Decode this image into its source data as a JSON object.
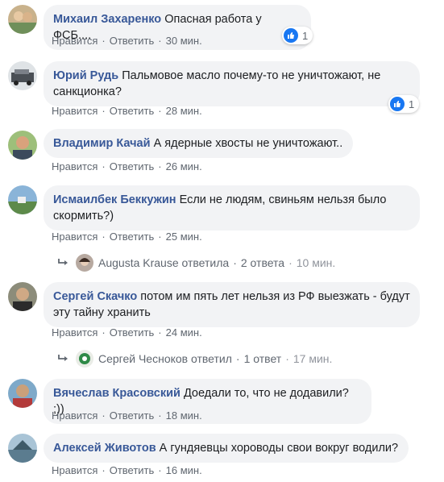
{
  "comments": [
    {
      "author": "Михаил Захаренко",
      "text": "Опасная работа у ФСБ....",
      "like": "Нравится",
      "reply": "Ответить",
      "time": "30 мин.",
      "reactions": "1"
    },
    {
      "author": "Юрий Рудь",
      "text": "Пальмовое масло почему-то не уничтожают, не санкционка?",
      "like": "Нравится",
      "reply": "Ответить",
      "time": "28 мин.",
      "reactions": "1"
    },
    {
      "author": "Владимир Качай",
      "text": "А ядерные хвосты не уничтожают..",
      "like": "Нравится",
      "reply": "Ответить",
      "time": "26 мин."
    },
    {
      "author": "Исмаилбек Беккужин",
      "text": "Если не людям, свиньям нельзя было скормить?)",
      "like": "Нравится",
      "reply": "Ответить",
      "time": "25 мин.",
      "replies": {
        "name": "Augusta Krause",
        "verb": "ответила",
        "count": "2 ответа",
        "time": "10 мин."
      }
    },
    {
      "author": "Сергей Скачко",
      "text": "потом им пять лет нельзя из РФ выезжать - будут эту тайну хранить",
      "like": "Нравится",
      "reply": "Ответить",
      "time": "24 мин.",
      "replies": {
        "name": "Сергей Чесноков",
        "verb": "ответил",
        "count": "1 ответ",
        "time": "17 мин."
      }
    },
    {
      "author": "Вячеслав Красовский",
      "text": "Доедали то, что не додавили? ;))",
      "like": "Нравится",
      "reply": "Ответить",
      "time": "18 мин."
    },
    {
      "author": "Алексей Животов",
      "text": "А гундяевцы хороводы свои вокруг водили?",
      "like": "Нравится",
      "reply": "Ответить",
      "time": "16 мин."
    }
  ],
  "colors": {
    "author": "#385898",
    "bubble": "#f2f3f5",
    "like_badge": "#1877f2",
    "meta": "#606770"
  }
}
